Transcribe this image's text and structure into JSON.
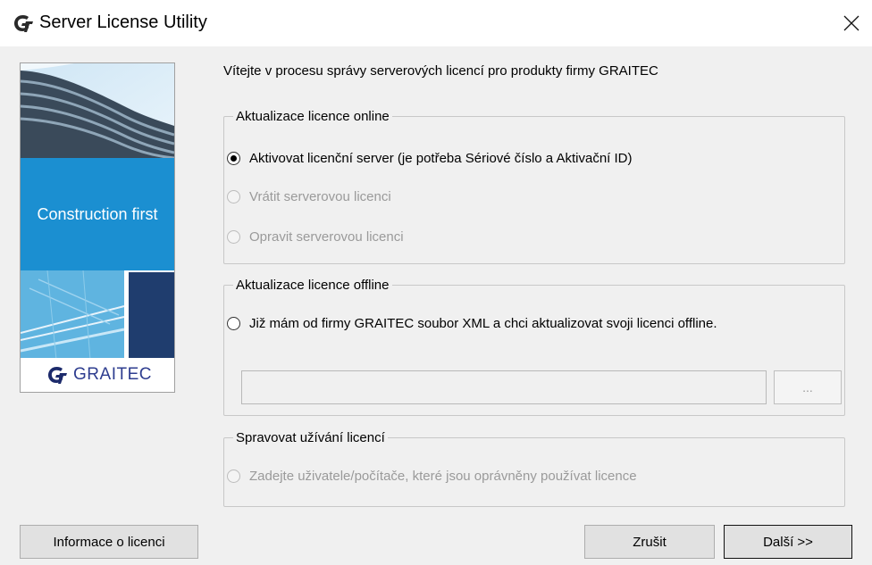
{
  "window": {
    "title": "Server License Utility",
    "close_glyph": "✕"
  },
  "brand": {
    "tagline": "Construction first",
    "logo_text": "GRAITEC",
    "accent_color": "#1b8fd1"
  },
  "welcome_text": "Vítejte v procesu správy serverových licencí pro produkty firmy GRAITEC",
  "groups": {
    "online": {
      "title": "Aktualizace licence online",
      "options": [
        {
          "label": "Aktivovat licenční server (je potřeba Sériové číslo a Aktivační ID)",
          "checked": true,
          "enabled": true
        },
        {
          "label": "Vrátit serverovou licenci",
          "checked": false,
          "enabled": false
        },
        {
          "label": "Opravit serverovou licenci",
          "checked": false,
          "enabled": false
        }
      ]
    },
    "offline": {
      "title": "Aktualizace licence offline",
      "option": {
        "label": "Již mám od firmy GRAITEC soubor XML a chci aktualizovat svoji licenci offline.",
        "checked": false,
        "enabled": true
      },
      "path_value": "",
      "browse_label": "..."
    },
    "manage": {
      "title": "Spravovat užívání licencí",
      "option": {
        "label": "Zadejte uživatele/počítače, které jsou oprávněny používat licence",
        "checked": false,
        "enabled": false
      }
    }
  },
  "buttons": {
    "info": "Informace o licenci",
    "cancel": "Zrušit",
    "next": "Další >>"
  }
}
